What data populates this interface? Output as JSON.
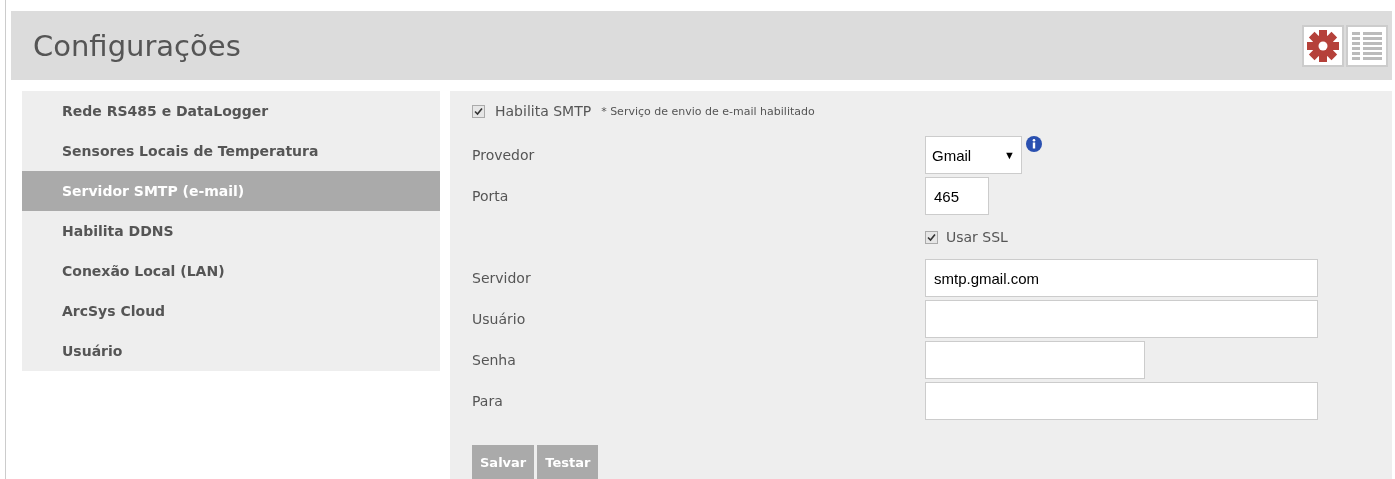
{
  "header": {
    "title": "Configurações"
  },
  "sidebar": {
    "items": [
      {
        "label": "Rede RS485 e DataLogger",
        "selected": false
      },
      {
        "label": "Sensores Locais de Temperatura",
        "selected": false
      },
      {
        "label": "Servidor SMTP (e-mail)",
        "selected": true
      },
      {
        "label": "Habilita DDNS",
        "selected": false
      },
      {
        "label": "Conexão Local (LAN)",
        "selected": false
      },
      {
        "label": "ArcSys Cloud",
        "selected": false
      },
      {
        "label": "Usuário",
        "selected": false
      }
    ]
  },
  "smtp": {
    "label": "Habilita SMTP",
    "checked": true,
    "note": "* Serviço de envio de e-mail habilitado"
  },
  "fields": [
    {
      "kind": "select",
      "label": "Provedor",
      "value": "Gmail",
      "arrow": "▼"
    },
    {
      "kind": "number",
      "label": "Porta",
      "value": "465"
    },
    {
      "kind": "checkbox",
      "label": "Usar SSL",
      "checked": true
    },
    {
      "kind": "text",
      "label": "Servidor",
      "value": "smtp.gmail.com"
    },
    {
      "kind": "text",
      "label": "Usuário"
    },
    {
      "kind": "password",
      "label": "Senha"
    },
    {
      "kind": "text",
      "label": "Para"
    }
  ],
  "buttons": [
    "Salvar",
    "Testar"
  ]
}
